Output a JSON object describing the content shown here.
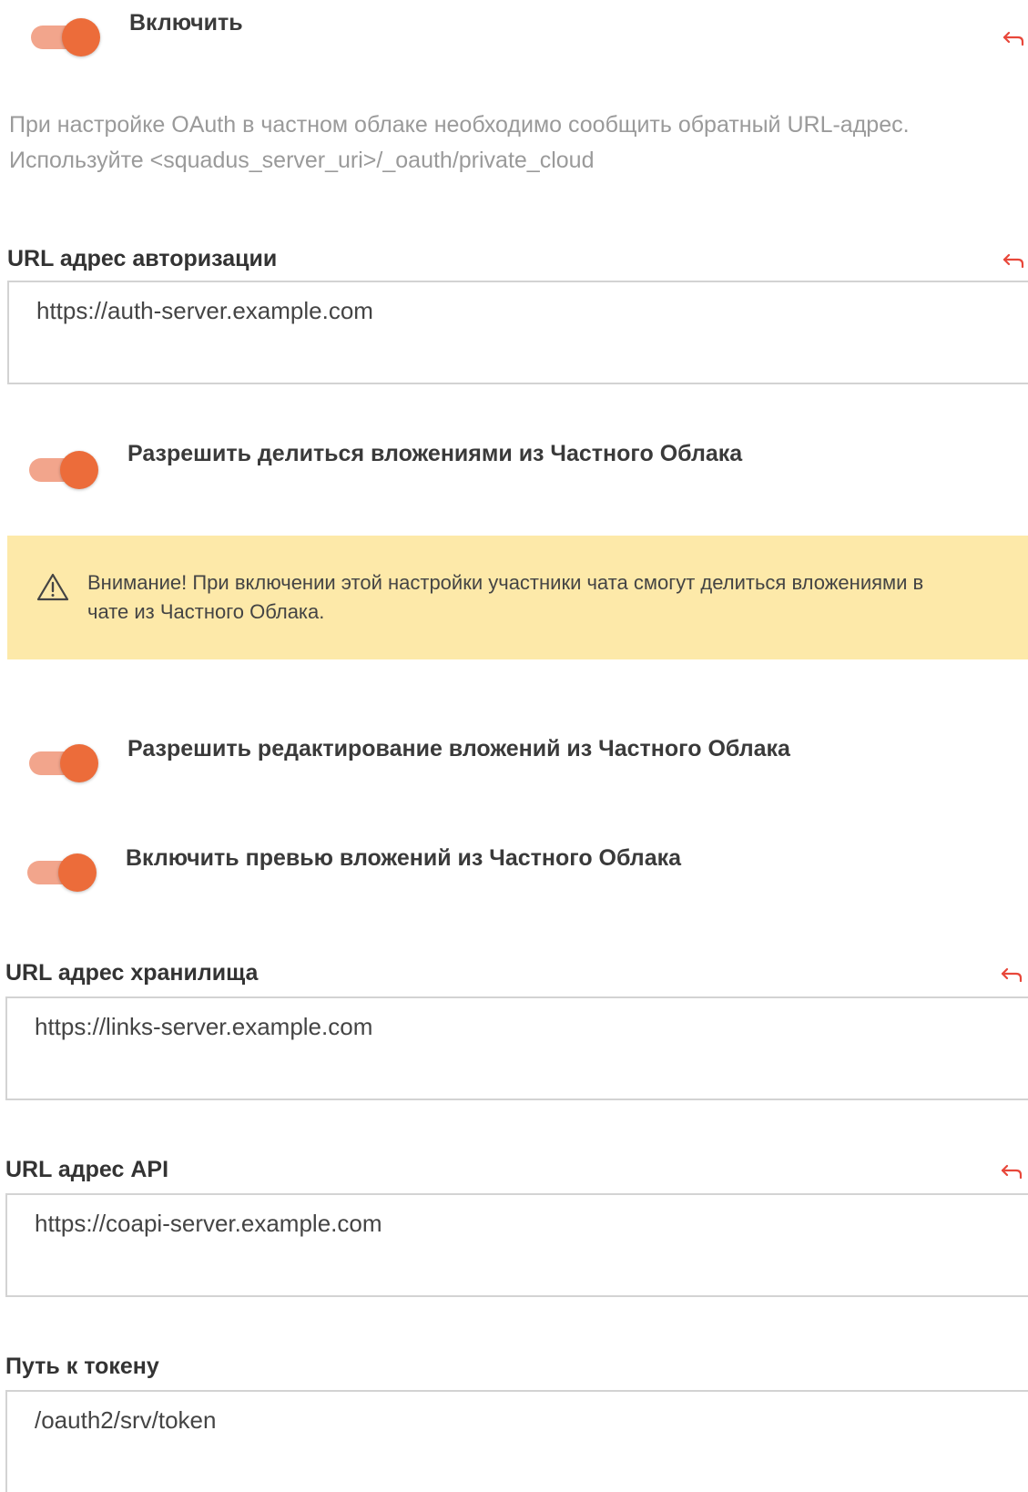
{
  "enable_toggle": {
    "label": "Включить",
    "state": "on"
  },
  "info": {
    "line1": "При настройке OAuth в частном облаке необходимо сообщить обратный URL-адрес.",
    "line2": "Используйте <squadus_server_uri>/_oauth/private_cloud"
  },
  "auth_url": {
    "label": "URL адрес авторизации",
    "value": "https://auth-server.example.com"
  },
  "share_toggle": {
    "label": "Разрешить делиться вложениями из Частного Облака",
    "state": "on"
  },
  "warning": {
    "text": "Внимание! При включении этой настройки участники чата смогут делиться вложениями в чате из Частного Облака."
  },
  "edit_toggle": {
    "label": "Разрешить редактирование вложений из Частного Облака",
    "state": "on"
  },
  "preview_toggle": {
    "label": "Включить превью вложений из Частного Облака",
    "state": "on"
  },
  "storage_url": {
    "label": "URL адрес хранилища",
    "value": "https://links-server.example.com"
  },
  "api_url": {
    "label": "URL адрес API",
    "value": "https://coapi-server.example.com"
  },
  "token_path": {
    "label": "Путь к токену",
    "value": "/oauth2/srv/token"
  },
  "icons": {
    "reset": "undo-arrow-icon",
    "warning": "warning-triangle-icon"
  },
  "colors": {
    "toggle_knob": "#ec6c3a",
    "toggle_track": "#f2a58c",
    "reset_icon": "#e8473a",
    "warning_bg": "#fde9a9",
    "info_text": "#9a9a9a"
  }
}
